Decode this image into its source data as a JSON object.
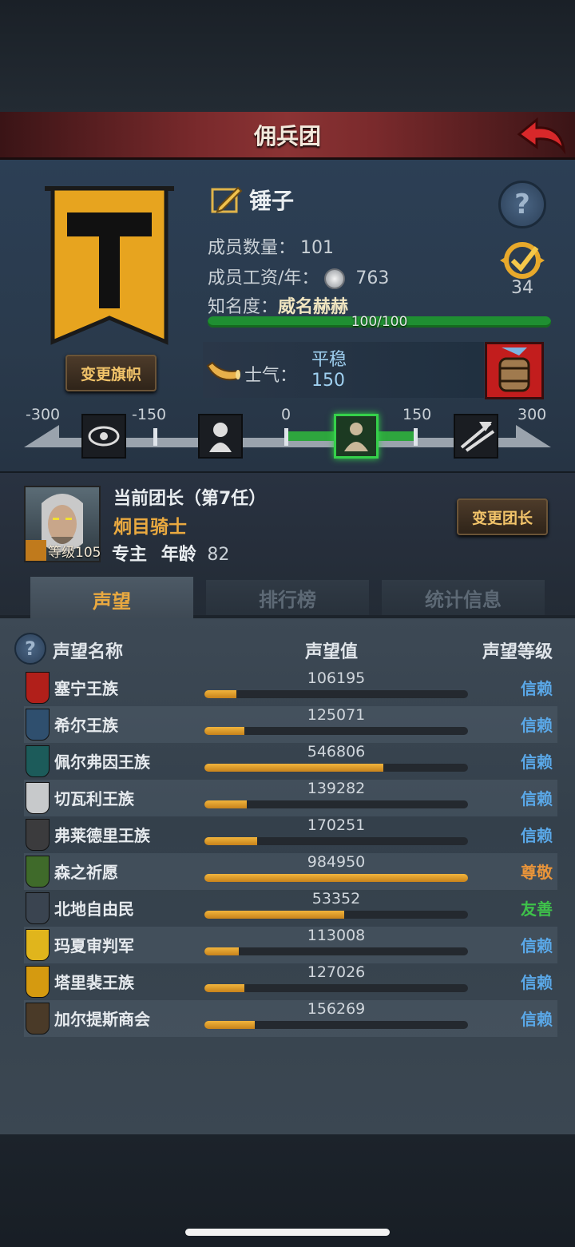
{
  "header": {
    "title": "佣兵团"
  },
  "company": {
    "name": "锤子",
    "members_label": "成员数量：",
    "members_value": "101",
    "salary_label": "成员工资/年：",
    "salary_value": "763",
    "fame_label": "知名度：",
    "fame_value": "威名赫赫",
    "fame_progress_text": "100/100",
    "fame_progress": 1.0,
    "rank_number": "34",
    "change_flag_label": "变更旗帜"
  },
  "morale": {
    "label": "士气：",
    "state": "平稳",
    "value": "150"
  },
  "morale_scale": {
    "ticks": [
      "-300",
      "-150",
      "0",
      "150",
      "300"
    ],
    "min": -300,
    "max": 300,
    "current": 150,
    "icons": [
      "eye-icon",
      "fear-icon",
      "calm-icon",
      "charge-icon"
    ]
  },
  "captain": {
    "title": "当前团长（第7任）",
    "name": "炯目骑士",
    "level_label": "等级105",
    "role": "专主",
    "age_label": "年龄",
    "age_value": "82",
    "change_label": "变更团长"
  },
  "tabs": [
    {
      "label": "声望",
      "active": true
    },
    {
      "label": "排行榜",
      "active": false
    },
    {
      "label": "统计信息",
      "active": false
    }
  ],
  "reputation": {
    "col_name": "声望名称",
    "col_value": "声望值",
    "col_level": "声望等级",
    "max_value": 1000000,
    "rows": [
      {
        "name": "塞宁王族",
        "value": "106195",
        "level": "信赖",
        "level_color": "#5aa8e8",
        "icon_color": "#b11f1a",
        "ratio": 0.12
      },
      {
        "name": "希尔王族",
        "value": "125071",
        "level": "信赖",
        "level_color": "#5aa8e8",
        "icon_color": "#2f4f6e",
        "ratio": 0.15
      },
      {
        "name": "佩尔弗因王族",
        "value": "546806",
        "level": "信赖",
        "level_color": "#5aa8e8",
        "icon_color": "#1c5b5a",
        "ratio": 0.68
      },
      {
        "name": "切瓦利王族",
        "value": "139282",
        "level": "信赖",
        "level_color": "#5aa8e8",
        "icon_color": "#c7c9cb",
        "ratio": 0.16
      },
      {
        "name": "弗莱德里王族",
        "value": "170251",
        "level": "信赖",
        "level_color": "#5aa8e8",
        "icon_color": "#3b3b3d",
        "ratio": 0.2
      },
      {
        "name": "森之祈愿",
        "value": "984950",
        "level": "尊敬",
        "level_color": "#e8943a",
        "icon_color": "#3f6a2a",
        "ratio": 1.0
      },
      {
        "name": "北地自由民",
        "value": "53352",
        "level": "友善",
        "level_color": "#3ec24a",
        "icon_color": "#3a4450",
        "ratio": 0.53
      },
      {
        "name": "玛夏审判军",
        "value": "113008",
        "level": "信赖",
        "level_color": "#5aa8e8",
        "icon_color": "#e0b51c",
        "ratio": 0.13
      },
      {
        "name": "塔里裴王族",
        "value": "127026",
        "level": "信赖",
        "level_color": "#5aa8e8",
        "icon_color": "#d59a10",
        "ratio": 0.15
      },
      {
        "name": "加尔提斯商会",
        "value": "156269",
        "level": "信赖",
        "level_color": "#5aa8e8",
        "icon_color": "#4a3a28",
        "ratio": 0.19
      }
    ]
  }
}
